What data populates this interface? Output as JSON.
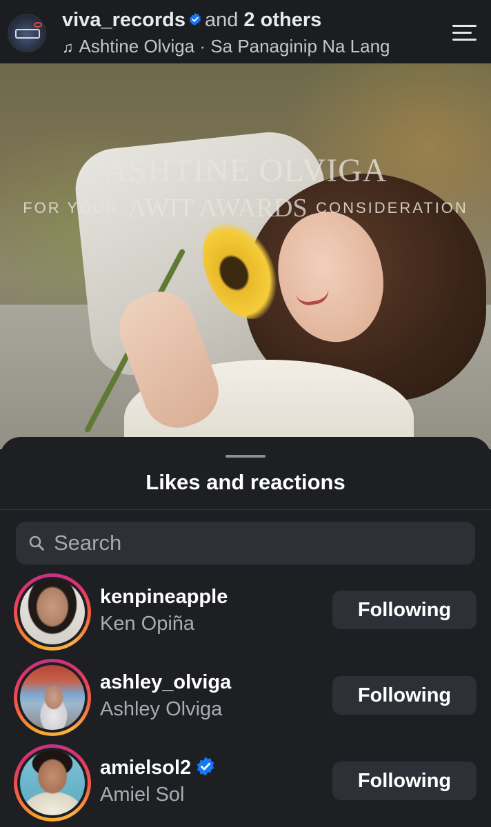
{
  "header": {
    "username": "viva_records",
    "joiner": "and",
    "others": "2 others",
    "audio_artist": "Ashtine Olviga",
    "audio_separator": "·",
    "audio_track": "Sa Panaginip Na Lang",
    "verified_color": "#1877f2"
  },
  "post": {
    "overlay_title": "ASHTINE OLVIGA",
    "overlay_sub_left": "FOR YOUR",
    "overlay_sub_mid": "AWIT AWARDS",
    "overlay_sub_right": "CONSIDERATION"
  },
  "sheet": {
    "title": "Likes and reactions",
    "search_placeholder": "Search"
  },
  "likers": [
    {
      "username": "kenpineapple",
      "full_name": "Ken Opiña",
      "verified": false,
      "button": "Following"
    },
    {
      "username": "ashley_olviga",
      "full_name": "Ashley Olviga",
      "verified": false,
      "button": "Following"
    },
    {
      "username": "amielsol2",
      "full_name": "Amiel Sol",
      "verified": true,
      "button": "Following"
    }
  ]
}
